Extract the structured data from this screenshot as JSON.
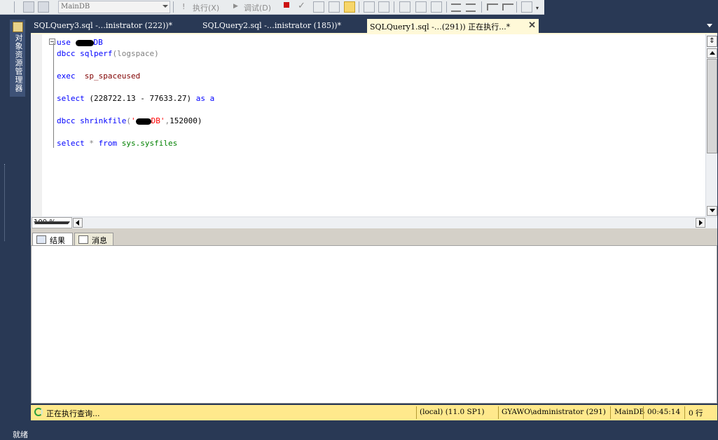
{
  "toolbar": {
    "database": "MainDB",
    "execute_label": "执行(X)",
    "debug_label": "调试(D)"
  },
  "side_panel": {
    "label": "对象资源管理器"
  },
  "tabs": [
    {
      "label": "SQLQuery3.sql -…inistrator (222))*"
    },
    {
      "label": "SQLQuery2.sql -…inistrator (185))*"
    },
    {
      "label": "SQLQuery1.sql -…(291)) 正在执行...*"
    }
  ],
  "editor": {
    "lines": [
      {
        "keyword": "use",
        "text": "DB"
      },
      {
        "keyword": "dbcc",
        "func": "sqlperf",
        "args": "(logspace)"
      },
      {
        "keyword": "exec",
        "proc": "sp_spaceused"
      },
      {
        "keyword": "select",
        "expr": "(228722.13 - 77633.27)",
        "as": "as",
        "alias": "a"
      },
      {
        "keyword": "dbcc",
        "func": "shrinkfile",
        "str": "DB'",
        "num": "152000)"
      },
      {
        "keyword": "select",
        "star": "*",
        "from": "from",
        "table": "sys.sysfiles"
      }
    ]
  },
  "zoom": "100 %",
  "results_tabs": {
    "results": "结果",
    "messages": "消息"
  },
  "status": {
    "message": "正在执行查询...",
    "server": "(local) (11.0 SP1)",
    "user": "GYAWO\\administrator (291)",
    "database": "MainDB",
    "elapsed": "00:45:14",
    "rows": "0 行"
  },
  "footer": {
    "ready": "就绪"
  },
  "colors": {
    "status_bar": "#ffe98c",
    "active_tab": "#fff9d8",
    "chrome": "#293955"
  }
}
